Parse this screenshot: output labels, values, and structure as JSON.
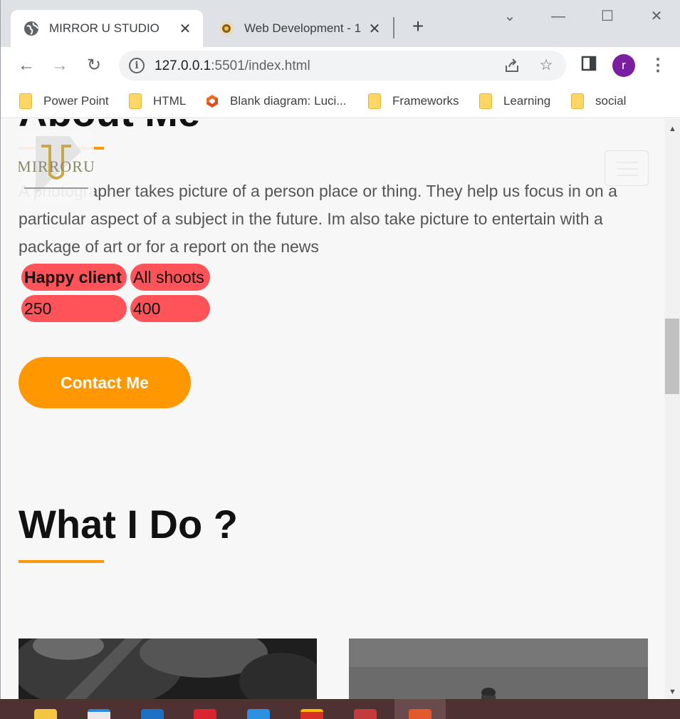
{
  "browser": {
    "tabs": [
      {
        "title": "MIRROR U STUDIO",
        "active": true,
        "icon": "globe-icon"
      },
      {
        "title": "Web Development - 1",
        "active": false,
        "icon": "crest-icon"
      }
    ],
    "url_host": "127.0.0.1",
    "url_rest": ":5501/index.html",
    "profile_initial": "r",
    "bookmarks": [
      {
        "label": "Power Point",
        "icon": "folder-icon"
      },
      {
        "label": "HTML",
        "icon": "folder-icon"
      },
      {
        "label": "Blank diagram: Luci...",
        "icon": "lucid-icon"
      },
      {
        "label": "Frameworks",
        "icon": "folder-icon"
      },
      {
        "label": "Learning",
        "icon": "folder-icon"
      },
      {
        "label": "social",
        "icon": "folder-icon"
      }
    ]
  },
  "page": {
    "about_heading": "About Me",
    "logo_text": "MIRRORU",
    "about_text": "A photographer takes picture of a person place or thing. They help us focus in on a particular aspect of a subject in the future. Im also take picture to entertain with a package of art or for a report on the news",
    "stats": {
      "happy_label": "Happy client",
      "shoots_label": "All shoots",
      "happy_value": "250",
      "shoots_value": "400"
    },
    "contact_button": "Contact Me",
    "whatido_heading": "What I Do ?"
  },
  "colors": {
    "accent": "#ff9800",
    "stat_bg": "#fe5358",
    "page_bg": "#f7f7f7",
    "avatar": "#7b1fa2"
  }
}
